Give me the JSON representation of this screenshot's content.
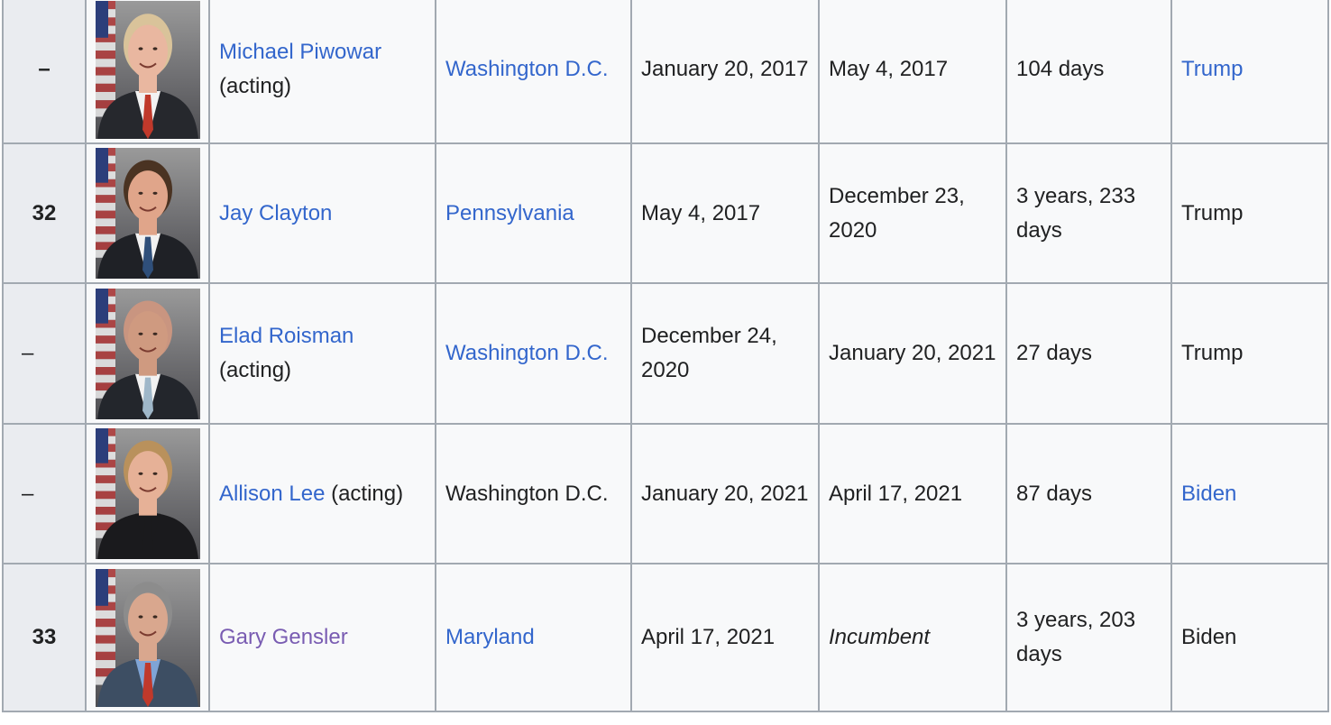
{
  "rows": [
    {
      "number": "–",
      "number_style": "bold",
      "name": "Michael Piwowar",
      "name_suffix": "(acting)",
      "name_visited": false,
      "state": "Washington D.C.",
      "state_link": true,
      "term_start": "January 20, 2017",
      "term_end": "May 4, 2017",
      "term_end_italic": false,
      "term_length": "104 days",
      "president": "Trump",
      "president_link": true,
      "photo": {
        "hair": "#d9c39a",
        "tie": "#c0392b",
        "suit": "#26282d",
        "shirt": "#f2f2f2",
        "skin": "#e9b7a0"
      }
    },
    {
      "number": "32",
      "number_style": "bold",
      "name": "Jay Clayton",
      "name_suffix": "",
      "name_visited": false,
      "state": "Pennsylvania",
      "state_link": true,
      "term_start": "May 4, 2017",
      "term_end": "December 23, 2020",
      "term_end_italic": false,
      "term_length": "3 years, 233 days",
      "president": "Trump",
      "president_link": false,
      "photo": {
        "hair": "#4a3322",
        "tie": "#2f4f7a",
        "suit": "#1f2126",
        "shirt": "#f2f2f2",
        "skin": "#e0a58a"
      }
    },
    {
      "number": "–",
      "number_style": "plain",
      "name": "Elad Roisman",
      "name_suffix": "(acting)",
      "name_visited": false,
      "state": "Washington D.C.",
      "state_link": true,
      "term_start": "December 24, 2020",
      "term_end": "January 20, 2021",
      "term_end_italic": false,
      "term_length": "27 days",
      "president": "Trump",
      "president_link": false,
      "photo": {
        "hair": "#c99580",
        "tie": "#9fb7c9",
        "suit": "#23262c",
        "shirt": "#f2f2f2",
        "skin": "#cf9a80"
      }
    },
    {
      "number": "–",
      "number_style": "plain",
      "name": "Allison Lee",
      "name_suffix": "(acting)",
      "name_visited": false,
      "state": "Washington D.C.",
      "state_link": false,
      "term_start": "January 20, 2021",
      "term_end": "April 17, 2021",
      "term_end_italic": false,
      "term_length": "87 days",
      "president": "Biden",
      "president_link": true,
      "photo": {
        "hair": "#b9915c",
        "tie": "#1a1a1d",
        "suit": "#1a1a1d",
        "shirt": "#1a1a1d",
        "skin": "#e6b197"
      }
    },
    {
      "number": "33",
      "number_style": "bold",
      "name": "Gary Gensler",
      "name_suffix": "",
      "name_visited": true,
      "state": "Maryland",
      "state_link": true,
      "term_start": "April 17, 2021",
      "term_end": "Incumbent",
      "term_end_italic": true,
      "term_length": "3 years, 203 days",
      "president": "Biden",
      "president_link": false,
      "photo": {
        "hair": "#8c8c8c",
        "tie": "#c0392b",
        "suit": "#3d4e63",
        "shirt": "#7fa4d6",
        "skin": "#d9a78e"
      }
    }
  ]
}
